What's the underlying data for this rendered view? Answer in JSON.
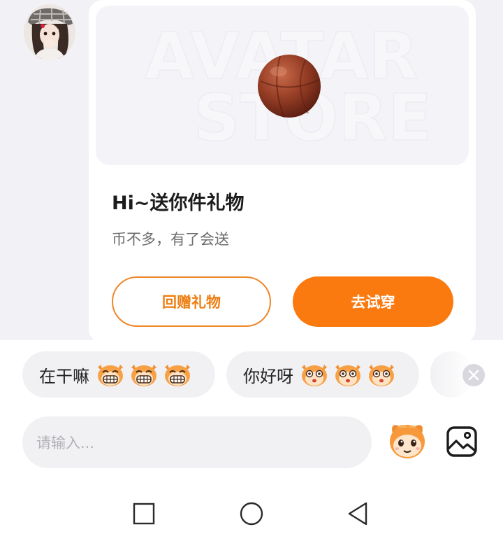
{
  "avatar": {
    "icon": "profile-avatar-image"
  },
  "card": {
    "watermark_line1": "AVATAR",
    "watermark_line2": "STORE",
    "gift_icon": "basketball-gift-icon",
    "title": "Hi~送你件礼物",
    "subtitle": "币不多，有了会送",
    "return_button": "回赠礼物",
    "try_button": "去试穿",
    "accent_color": "#fb7a10"
  },
  "quick_replies": [
    {
      "text": "在干嘛",
      "emoji_icon": "grinning-face-sticker-icon",
      "emoji_count": 3
    },
    {
      "text": "你好呀",
      "emoji_icon": "surprised-face-sticker-icon",
      "emoji_count": 3
    }
  ],
  "composer": {
    "placeholder": "请输入...",
    "sticker_icon": "mascot-sticker-icon",
    "image_icon": "image-icon",
    "close_icon": "close-icon"
  },
  "system_nav": {
    "icons": [
      "recent-apps-icon",
      "home-icon",
      "back-icon"
    ]
  }
}
